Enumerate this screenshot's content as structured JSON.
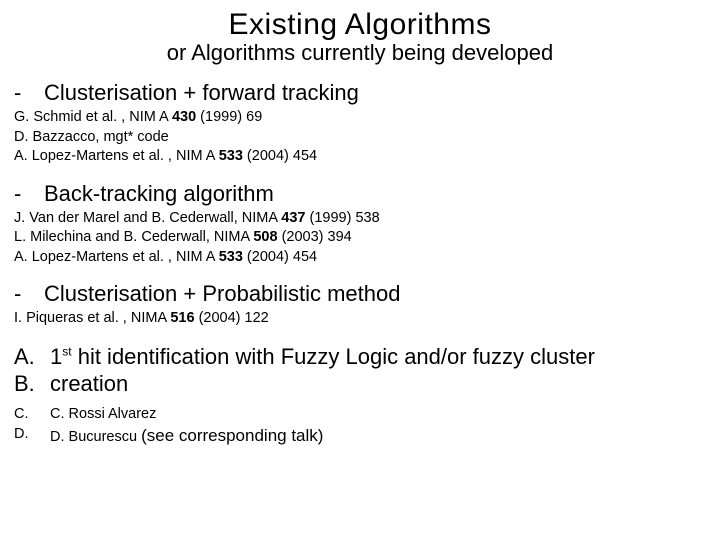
{
  "title": "Existing Algorithms",
  "subtitle": "or Algorithms currently being developed",
  "sections": [
    {
      "dash": "-",
      "head": "Clusterisation + forward tracking",
      "refs": [
        {
          "pre": "G. Schmid et al. , NIM A ",
          "bold": "430",
          "post": " (1999) 69"
        },
        {
          "pre": "D. Bazzacco, mgt* code",
          "bold": "",
          "post": ""
        },
        {
          "pre": "A.   Lopez-Martens et al. , NIM A ",
          "bold": "533",
          "post": " (2004) 454"
        }
      ]
    },
    {
      "dash": "-",
      "head": "Back-tracking algorithm",
      "refs": [
        {
          "pre": "J. Van der Marel and B. Cederwall, NIMA ",
          "bold": "437",
          "post": " (1999) 538"
        },
        {
          "pre": "L. Milechina and B. Cederwall, NIMA ",
          "bold": "508",
          "post": " (2003) 394"
        },
        {
          "pre": "A. Lopez-Martens et al. , NIM A ",
          "bold": "533",
          "post": " (2004) 454"
        }
      ]
    },
    {
      "dash": "-",
      "head": "Clusterisation + Probabilistic method",
      "refs": [
        {
          "pre": "I. Piqueras et al. , NIMA  ",
          "bold": "516",
          "post": " (2004) 122"
        }
      ]
    }
  ],
  "fuzzy": {
    "a_label": "A.",
    "a_text_1": "1",
    "a_sup": "st",
    "a_text_2": " hit identification with Fuzzy Logic and/or fuzzy cluster",
    "b_label": "B.",
    "b_text": "creation"
  },
  "credits": {
    "c_label": "C.",
    "c_text": "C. Rossi Alvarez",
    "d_label": "D.",
    "d_text": "D. Bucurescu ",
    "d_talk": "(see corresponding talk)"
  }
}
